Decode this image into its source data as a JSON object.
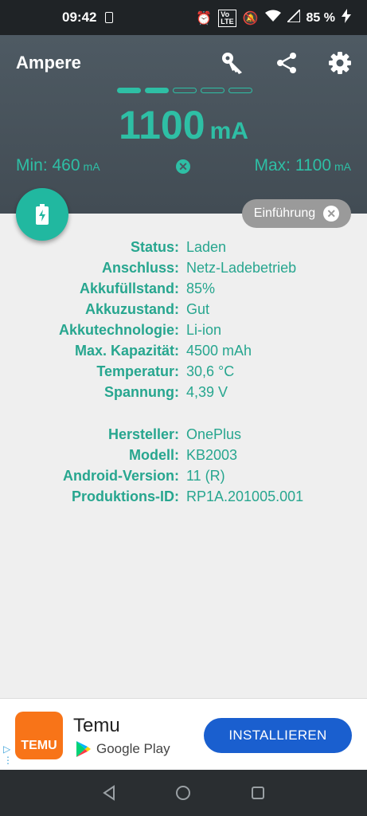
{
  "status_bar": {
    "time": "09:42",
    "battery": "85 %"
  },
  "app": {
    "title": "Ampere"
  },
  "measurement": {
    "value": "1100",
    "unit": "mA",
    "min_label": "Min: 460",
    "min_unit": "mA",
    "max_label": "Max: 1100",
    "max_unit": "mA",
    "active_page_dots": 2,
    "total_page_dots": 5
  },
  "intro_chip": {
    "label": "Einführung"
  },
  "battery_info": [
    {
      "label": "Status:",
      "value": "Laden"
    },
    {
      "label": "Anschluss:",
      "value": "Netz-Ladebetrieb"
    },
    {
      "label": "Akkufüllstand:",
      "value": "85%"
    },
    {
      "label": "Akkuzustand:",
      "value": "Gut"
    },
    {
      "label": "Akkutechnologie:",
      "value": "Li-ion"
    },
    {
      "label": "Max. Kapazität:",
      "value": "4500 mAh"
    },
    {
      "label": "Temperatur:",
      "value": "30,6 °C"
    },
    {
      "label": "Spannung:",
      "value": "4,39 V"
    }
  ],
  "device_info": [
    {
      "label": "Hersteller:",
      "value": "OnePlus"
    },
    {
      "label": "Modell:",
      "value": "KB2003"
    },
    {
      "label": "Android-Version:",
      "value": "11 (R)"
    },
    {
      "label": "Produktions-ID:",
      "value": "RP1A.201005.001"
    }
  ],
  "ad": {
    "logo_text": "TEMU",
    "app_name": "Temu",
    "store_name": "Google Play",
    "install_label": "INSTALLIEREN"
  },
  "colors": {
    "accent": "#2ebfa5",
    "header": "#4b5760",
    "install": "#1a5fcf",
    "temu": "#f87418"
  }
}
